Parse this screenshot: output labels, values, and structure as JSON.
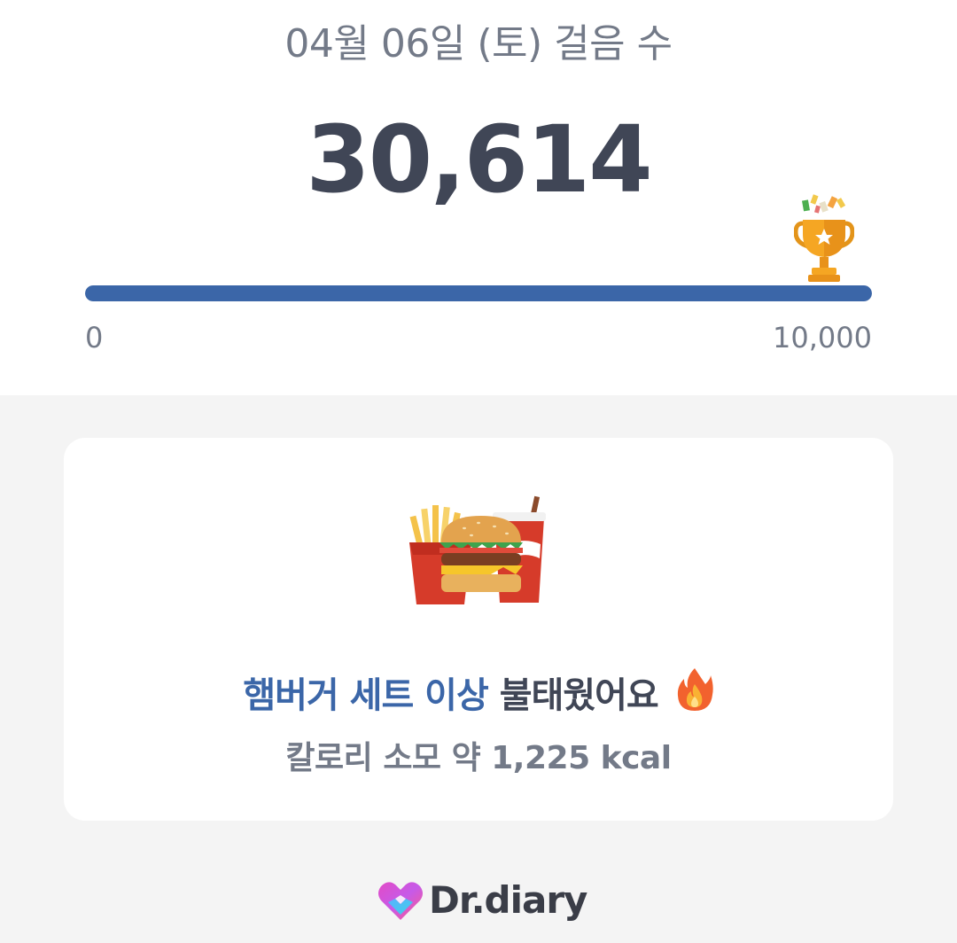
{
  "header": {
    "date_title": "04월 06일 (토) 걸음 수",
    "step_count": "30,614"
  },
  "progress": {
    "min_label": "0",
    "max_label": "10,000",
    "steps": 30614,
    "goal": 10000,
    "fill_fraction": 1.0,
    "goal_icon": "trophy-icon",
    "fill_color": "#3b66a8",
    "track_color": "#dfe3ea"
  },
  "card": {
    "food_icon": "hamburger-set-icon",
    "headline_highlight": "햄버거 세트 이상",
    "headline_rest": "불태웠어요",
    "headline_icon": "fire-icon",
    "subline": "칼로리 소모 약 1,225 kcal",
    "highlight_color": "#3b66a8"
  },
  "footer": {
    "brand": "Dr.diary",
    "logo_icon": "heart-logo-icon"
  }
}
